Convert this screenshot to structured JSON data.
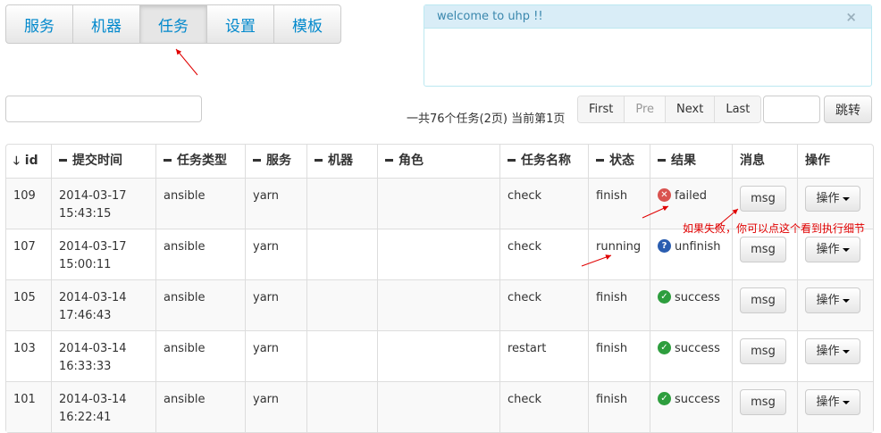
{
  "nav": {
    "tabs": [
      {
        "label": "服务"
      },
      {
        "label": "机器"
      },
      {
        "label": "任务"
      },
      {
        "label": "设置"
      },
      {
        "label": "模板"
      }
    ],
    "active_index": 2
  },
  "alert": {
    "message": "welcome to uhp !!",
    "close": "×"
  },
  "search": {
    "value": ""
  },
  "pagination": {
    "info": "一共76个任务(2页) 当前第1页",
    "first": "First",
    "pre": "Pre",
    "next": "Next",
    "last": "Last",
    "jump_value": "",
    "jump_label": "跳转"
  },
  "table": {
    "headers": {
      "id": "id",
      "submit_time": "提交时间",
      "task_type": "任务类型",
      "service": "服务",
      "machine": "机器",
      "role": "角色",
      "task_name": "任务名称",
      "status": "状态",
      "result": "结果",
      "message": "消息",
      "action": "操作"
    },
    "rows": [
      {
        "id": "109",
        "date": "2014-03-17",
        "time": "15:43:15",
        "type": "ansible",
        "service": "yarn",
        "machine": "",
        "role": "",
        "name": "check",
        "status": "finish",
        "result": "failed",
        "result_icon": "failed-icon",
        "msg": "msg",
        "action": "操作"
      },
      {
        "id": "107",
        "date": "2014-03-17",
        "time": "15:00:11",
        "type": "ansible",
        "service": "yarn",
        "machine": "",
        "role": "",
        "name": "check",
        "status": "running",
        "result": "unfinish",
        "result_icon": "question-icon",
        "msg": "msg",
        "action": "操作"
      },
      {
        "id": "105",
        "date": "2014-03-14",
        "time": "17:46:43",
        "type": "ansible",
        "service": "yarn",
        "machine": "",
        "role": "",
        "name": "check",
        "status": "finish",
        "result": "success",
        "result_icon": "success-icon",
        "msg": "msg",
        "action": "操作"
      },
      {
        "id": "103",
        "date": "2014-03-14",
        "time": "16:33:33",
        "type": "ansible",
        "service": "yarn",
        "machine": "",
        "role": "",
        "name": "restart",
        "status": "finish",
        "result": "success",
        "result_icon": "success-icon",
        "msg": "msg",
        "action": "操作"
      },
      {
        "id": "101",
        "date": "2014-03-14",
        "time": "16:22:41",
        "type": "ansible",
        "service": "yarn",
        "machine": "",
        "role": "",
        "name": "check",
        "status": "finish",
        "result": "success",
        "result_icon": "success-icon",
        "msg": "msg",
        "action": "操作"
      }
    ]
  },
  "annotation": {
    "text": "如果失败，你可以点这个看到执行细节",
    "color": "#e00000"
  },
  "colors": {
    "link": "#0088cc",
    "failed": "#d9534f",
    "success": "#2e9e3e",
    "question": "#2a5db0"
  }
}
